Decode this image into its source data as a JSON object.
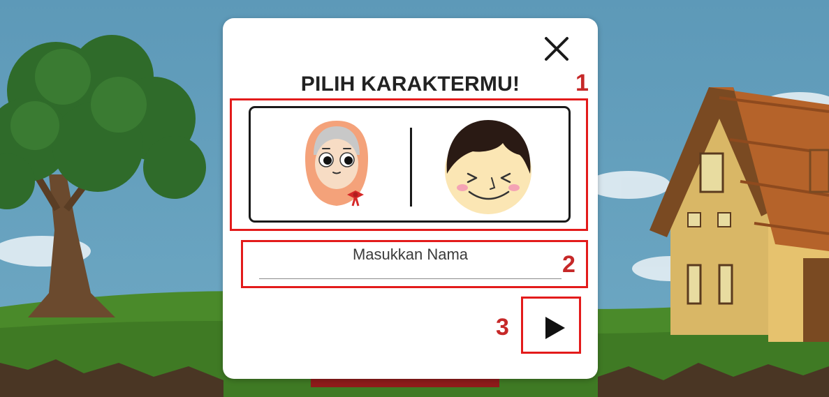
{
  "dialog": {
    "title": "PILIH KARAKTERMU!",
    "name_label": "Masukkan Nama",
    "close_icon": "close-icon",
    "play_icon": "play-icon",
    "characters": [
      {
        "icon": "girl-hijab-icon"
      },
      {
        "icon": "boy-smiling-icon"
      }
    ]
  },
  "annotations": [
    "1",
    "2",
    "3"
  ],
  "colors": {
    "annotation": "#e31b1b",
    "annotation_text": "#c62828",
    "sky": "#5e97b4",
    "grass": "#4a8a2a"
  }
}
